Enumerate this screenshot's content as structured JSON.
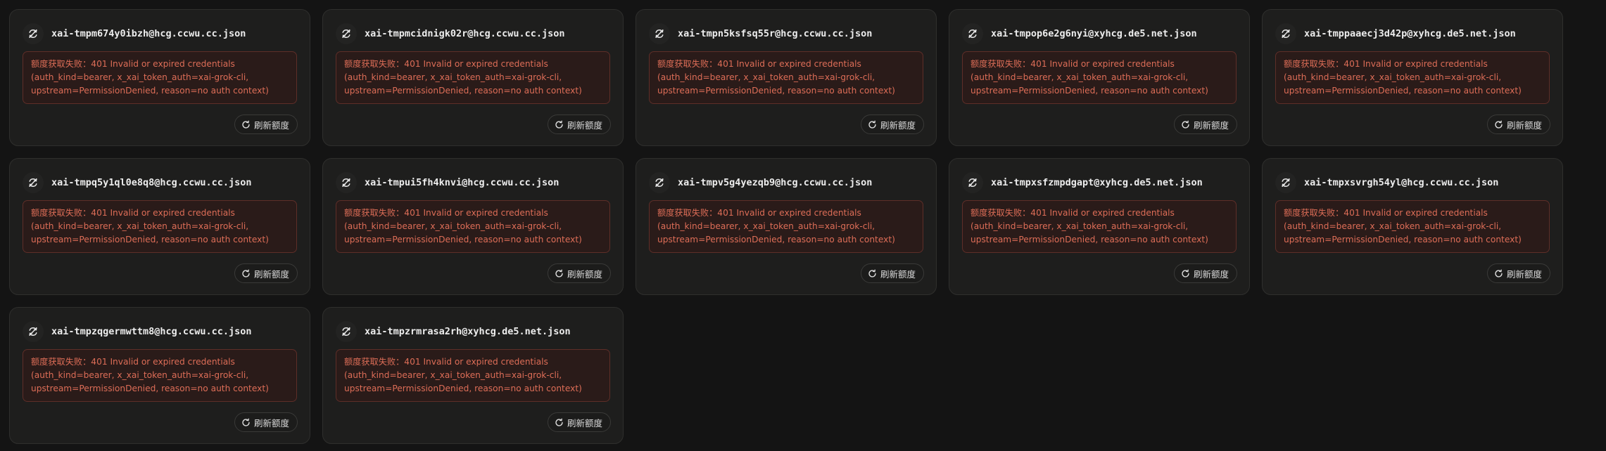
{
  "labels": {
    "refresh_button": "刷新额度"
  },
  "icons": {
    "card_icon": "no-sync-icon",
    "refresh_icon": "refresh-icon"
  },
  "colors": {
    "page_bg": "#141414",
    "card_bg": "#1e1e1d",
    "error_bg": "#2a1b19",
    "error_border": "#5e2e28",
    "error_text": "#dd6d57"
  },
  "cards": [
    {
      "title": "xai-tmpm674y0ibzh@hcg.ccwu.cc.json",
      "error_lines": [
        "额度获取失败：401 Invalid or expired credentials",
        "(auth_kind=bearer, x_xai_token_auth=xai-grok-cli,",
        "upstream=PermissionDenied, reason=no auth context)"
      ]
    },
    {
      "title": "xai-tmpmcidnigk02r@hcg.ccwu.cc.json",
      "error_lines": [
        "额度获取失败：401 Invalid or expired credentials",
        "(auth_kind=bearer, x_xai_token_auth=xai-grok-cli,",
        "upstream=PermissionDenied, reason=no auth context)"
      ]
    },
    {
      "title": "xai-tmpn5ksfsq55r@hcg.ccwu.cc.json",
      "error_lines": [
        "额度获取失败：401 Invalid or expired credentials",
        "(auth_kind=bearer, x_xai_token_auth=xai-grok-cli,",
        "upstream=PermissionDenied, reason=no auth context)"
      ]
    },
    {
      "title": "xai-tmpop6e2g6nyi@xyhcg.de5.net.json",
      "error_lines": [
        "额度获取失败：401 Invalid or expired credentials",
        "(auth_kind=bearer, x_xai_token_auth=xai-grok-cli,",
        "upstream=PermissionDenied, reason=no auth context)"
      ]
    },
    {
      "title": "xai-tmppaaecj3d42p@xyhcg.de5.net.json",
      "error_lines": [
        "额度获取失败：401 Invalid or expired credentials",
        "(auth_kind=bearer, x_xai_token_auth=xai-grok-cli,",
        "upstream=PermissionDenied, reason=no auth context)"
      ]
    },
    {
      "title": "xai-tmpq5y1ql0e8q8@hcg.ccwu.cc.json",
      "error_lines": [
        "额度获取失败：401 Invalid or expired credentials",
        "(auth_kind=bearer, x_xai_token_auth=xai-grok-cli,",
        "upstream=PermissionDenied, reason=no auth context)"
      ]
    },
    {
      "title": "xai-tmpui5fh4knvi@hcg.ccwu.cc.json",
      "error_lines": [
        "额度获取失败：401 Invalid or expired credentials",
        "(auth_kind=bearer, x_xai_token_auth=xai-grok-cli,",
        "upstream=PermissionDenied, reason=no auth context)"
      ]
    },
    {
      "title": "xai-tmpv5g4yezqb9@hcg.ccwu.cc.json",
      "error_lines": [
        "额度获取失败：401 Invalid or expired credentials",
        "(auth_kind=bearer, x_xai_token_auth=xai-grok-cli,",
        "upstream=PermissionDenied, reason=no auth context)"
      ]
    },
    {
      "title": "xai-tmpxsfzmpdgapt@xyhcg.de5.net.json",
      "error_lines": [
        "额度获取失败：401 Invalid or expired credentials",
        "(auth_kind=bearer, x_xai_token_auth=xai-grok-cli,",
        "upstream=PermissionDenied, reason=no auth context)"
      ]
    },
    {
      "title": "xai-tmpxsvrgh54yl@hcg.ccwu.cc.json",
      "error_lines": [
        "额度获取失败：401 Invalid or expired credentials",
        "(auth_kind=bearer, x_xai_token_auth=xai-grok-cli,",
        "upstream=PermissionDenied, reason=no auth context)"
      ]
    },
    {
      "title": "xai-tmpzqgermwttm8@hcg.ccwu.cc.json",
      "error_lines": [
        "额度获取失败：401 Invalid or expired credentials",
        "(auth_kind=bearer, x_xai_token_auth=xai-grok-cli,",
        "upstream=PermissionDenied, reason=no auth context)"
      ]
    },
    {
      "title": "xai-tmpzrmrasa2rh@xyhcg.de5.net.json",
      "error_lines": [
        "额度获取失败：401 Invalid or expired credentials",
        "(auth_kind=bearer, x_xai_token_auth=xai-grok-cli,",
        "upstream=PermissionDenied, reason=no auth context)"
      ]
    }
  ]
}
